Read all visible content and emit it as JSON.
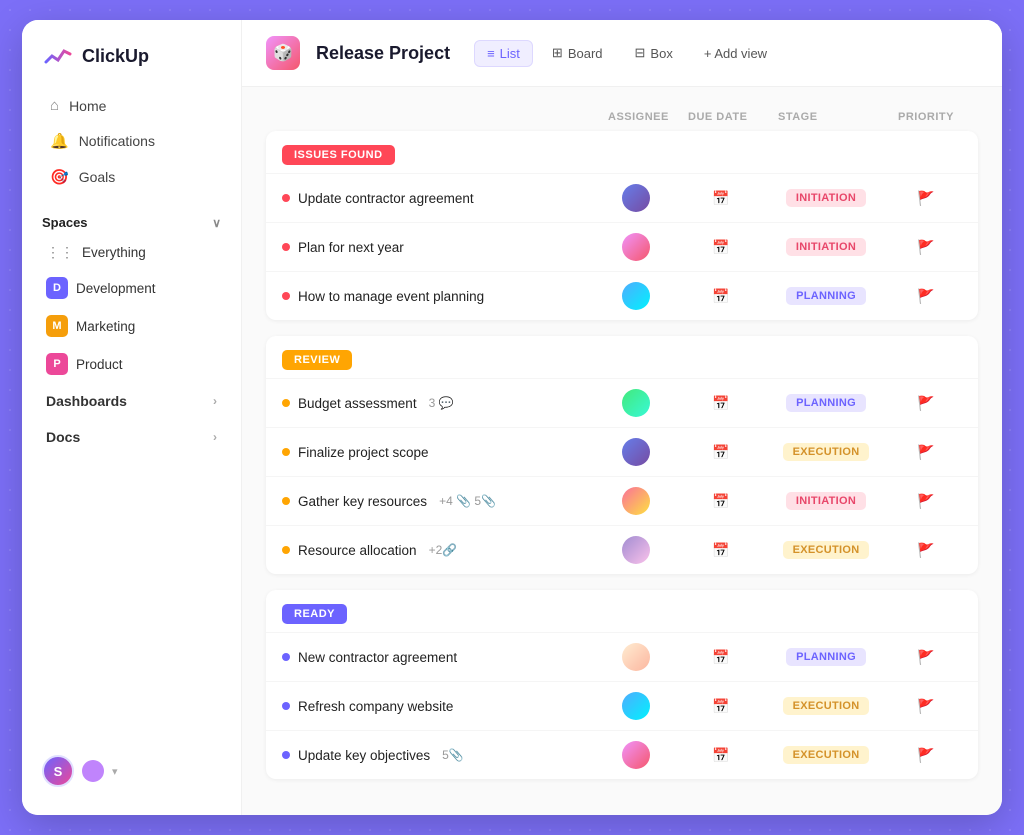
{
  "app": {
    "name": "ClickUp"
  },
  "sidebar": {
    "nav": [
      {
        "id": "home",
        "label": "Home",
        "icon": "⌂"
      },
      {
        "id": "notifications",
        "label": "Notifications",
        "icon": "🔔"
      },
      {
        "id": "goals",
        "label": "Goals",
        "icon": "🎯"
      }
    ],
    "spaces_label": "Spaces",
    "spaces": [
      {
        "id": "everything",
        "label": "Everything",
        "type": "grid"
      },
      {
        "id": "development",
        "label": "Development",
        "badge": "D",
        "badge_class": "badge-d"
      },
      {
        "id": "marketing",
        "label": "Marketing",
        "badge": "M",
        "badge_class": "badge-m"
      },
      {
        "id": "product",
        "label": "Product",
        "badge": "P",
        "badge_class": "badge-p"
      }
    ],
    "other": [
      {
        "id": "dashboards",
        "label": "Dashboards"
      },
      {
        "id": "docs",
        "label": "Docs"
      }
    ],
    "user_initial": "S"
  },
  "header": {
    "project_name": "Release Project",
    "project_icon": "🎲",
    "views": [
      {
        "id": "list",
        "label": "List",
        "icon": "≡",
        "active": true
      },
      {
        "id": "board",
        "label": "Board",
        "icon": "⊞",
        "active": false
      },
      {
        "id": "box",
        "label": "Box",
        "icon": "⊟",
        "active": false
      }
    ],
    "add_view_label": "+ Add view"
  },
  "table": {
    "columns": [
      "",
      "ASSIGNEE",
      "DUE DATE",
      "STAGE",
      "PRIORITY"
    ],
    "sections": [
      {
        "id": "issues",
        "label": "ISSUES FOUND",
        "label_class": "label-issues",
        "tasks": [
          {
            "id": 1,
            "name": "Update contractor agreement",
            "dot": "dot-red",
            "assignee": "a1",
            "stage": "INITIATION",
            "stage_class": "stage-initiation"
          },
          {
            "id": 2,
            "name": "Plan for next year",
            "dot": "dot-red",
            "assignee": "a2",
            "stage": "INITIATION",
            "stage_class": "stage-initiation"
          },
          {
            "id": 3,
            "name": "How to manage event planning",
            "dot": "dot-red",
            "assignee": "a3",
            "stage": "PLANNING",
            "stage_class": "stage-planning"
          }
        ]
      },
      {
        "id": "review",
        "label": "REVIEW",
        "label_class": "label-review",
        "tasks": [
          {
            "id": 4,
            "name": "Budget assessment",
            "dot": "dot-yellow",
            "meta": "3",
            "assignee": "a4",
            "stage": "PLANNING",
            "stage_class": "stage-planning"
          },
          {
            "id": 5,
            "name": "Finalize project scope",
            "dot": "dot-yellow",
            "assignee": "a1",
            "stage": "EXECUTION",
            "stage_class": "stage-execution"
          },
          {
            "id": 6,
            "name": "Gather key resources",
            "dot": "dot-yellow",
            "meta": "+4  5📎",
            "assignee": "a5",
            "stage": "INITIATION",
            "stage_class": "stage-initiation"
          },
          {
            "id": 7,
            "name": "Resource allocation",
            "dot": "dot-yellow",
            "meta": "+2🔗",
            "assignee": "a6",
            "stage": "EXECUTION",
            "stage_class": "stage-execution"
          }
        ]
      },
      {
        "id": "ready",
        "label": "READY",
        "label_class": "label-ready",
        "tasks": [
          {
            "id": 8,
            "name": "New contractor agreement",
            "dot": "dot-purple",
            "assignee": "a7",
            "stage": "PLANNING",
            "stage_class": "stage-planning"
          },
          {
            "id": 9,
            "name": "Refresh company website",
            "dot": "dot-purple",
            "assignee": "a3",
            "stage": "EXECUTION",
            "stage_class": "stage-execution"
          },
          {
            "id": 10,
            "name": "Update key objectives",
            "dot": "dot-purple",
            "meta": "5📎",
            "assignee": "a2",
            "stage": "EXECUTION",
            "stage_class": "stage-execution"
          }
        ]
      }
    ]
  }
}
